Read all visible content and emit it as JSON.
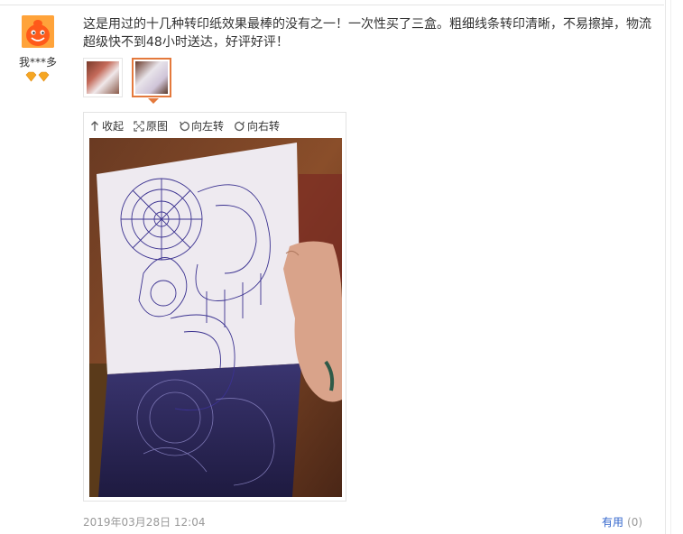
{
  "user": {
    "name": "我***多",
    "avatar_icon": "orange-face-avatar-icon",
    "badge_icon": "diamond-level-icon"
  },
  "review": {
    "text": "这是用过的十几种转印纸效果最棒的没有之一！一次性买了三盒。粗细线条转印清晰，不易擦掉，物流超级快不到48小时送达，好评好评！"
  },
  "thumbnails": [
    {
      "alt": "photo-1",
      "selected": false
    },
    {
      "alt": "photo-2",
      "selected": true
    }
  ],
  "viewer": {
    "toolbar": {
      "collapse": "收起",
      "original": "原图",
      "rotate_left": "向左转",
      "rotate_right": "向右转"
    }
  },
  "footer": {
    "date": "2019年03月28日 12:04",
    "useful_label": "有用",
    "useful_count": "(0)"
  },
  "colors": {
    "accent": "#e4793c",
    "link": "#3366cc",
    "muted": "#999999",
    "avatar": "#ff9a2a"
  }
}
